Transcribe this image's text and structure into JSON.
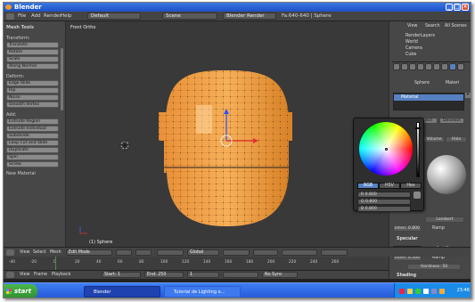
{
  "window": {
    "title": "Blender"
  },
  "info_header": {
    "menus": [
      "File",
      "Add",
      "Render",
      "Help"
    ],
    "layout": "Default",
    "scene": "Scene",
    "engine": "Blender Render",
    "stats": "Fa:640-640 | Sphere"
  },
  "tool_shelf": {
    "title": "Mesh Tools",
    "sections": [
      {
        "title": "Transform:",
        "buttons": [
          "Translate",
          "Rotate",
          "Scale",
          "Along Normal"
        ]
      },
      {
        "title": "Deform:",
        "buttons": [
          "Edge Slide",
          "Rip",
          "Noise",
          "Smooth Vertex"
        ]
      },
      {
        "title": "Add:",
        "buttons": [
          "Extrude Region",
          "Extrude Individual",
          "Subdivide",
          "Loop Cut and Slide",
          "Duplicate",
          "Spin",
          "Screw"
        ]
      }
    ],
    "new_material": "New Material"
  },
  "viewport": {
    "view_label": "Front Ortho",
    "object_label": "(1) Sphere"
  },
  "outliner": {
    "items": [
      "RenderLayers",
      "World",
      "Camera",
      "Cube"
    ],
    "view": "View",
    "search": "Search",
    "scope": "All Scenes"
  },
  "properties": {
    "context": "Sphere",
    "material_tab": "Materi",
    "material_slot": "Material",
    "btn_select": "lect",
    "btn_deselect": "Deselect",
    "diffuse_shader": "Lambert",
    "intensity": "Inten: 0.800",
    "ramp": "Ramp",
    "specular_title": "Specular",
    "specular_shader": "CookTorr",
    "spec_intensity": "Inten: 0.500",
    "hardness": "Hardness: 50",
    "shading": "Shading",
    "volume": "Volume",
    "halo": "Halo"
  },
  "color_picker": {
    "tabs": [
      "RGB",
      "HSV",
      "Hex"
    ],
    "active_tab": "RGB",
    "r": "R 0.800",
    "g": "G 0.800",
    "b": "B 0.800",
    "color": "#cccccc"
  },
  "viewport_header": {
    "menus": [
      "View",
      "Select",
      "Mesh"
    ],
    "mode": "Edit Mode",
    "orientation": "Global"
  },
  "timeline": {
    "ticks": [
      "-40",
      "-20",
      "0",
      "20",
      "40",
      "60",
      "80",
      "100",
      "120",
      "140",
      "160",
      "180",
      "200",
      "220",
      "240",
      "260"
    ],
    "menus": [
      "View",
      "Frame",
      "Playback"
    ],
    "start": "Start: 1",
    "end": "End: 250",
    "current": "1",
    "sync": "No Sync"
  },
  "taskbar": {
    "start": "start",
    "tasks": [
      "Blender",
      "Tutorial de Lighting e..."
    ],
    "clock": "23:46"
  },
  "colors": {
    "accent": "#f0a030",
    "selection": "#ffb040",
    "wire": "#ff9d1a"
  }
}
